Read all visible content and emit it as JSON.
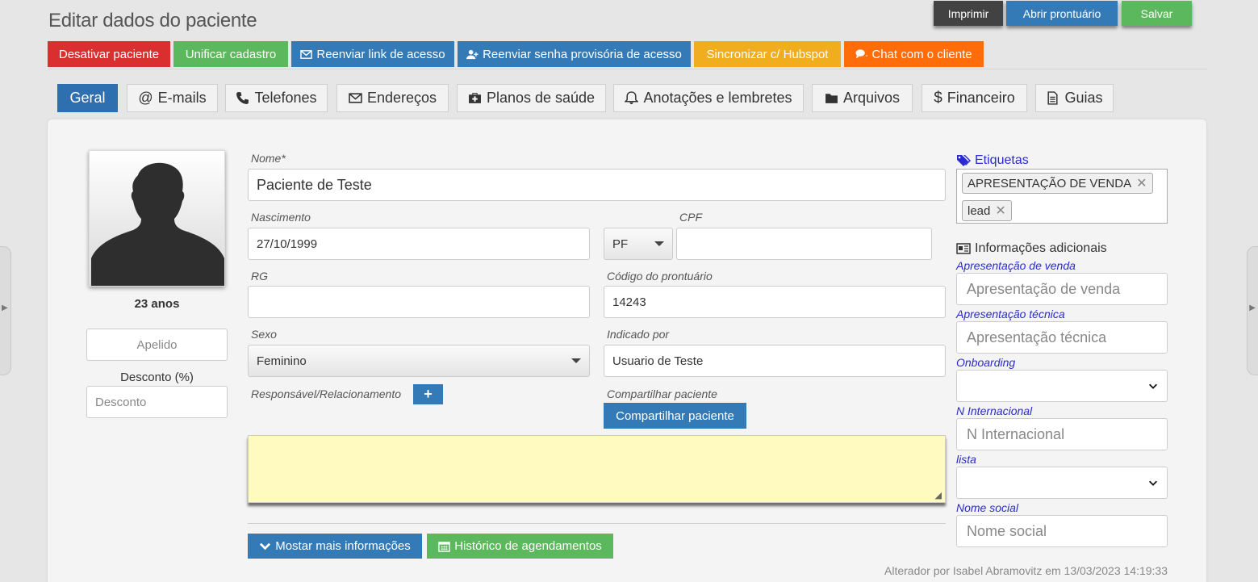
{
  "page": {
    "title": "Editar dados do paciente"
  },
  "actions": {
    "print": "Imprimir",
    "open_record": "Abrir prontuário",
    "save": "Salvar"
  },
  "toolbar": {
    "deactivate": "Desativar paciente",
    "merge": "Unificar cadastro",
    "resend_link": "Reenviar link de acesso",
    "resend_password": "Reenviar senha provisória de acesso",
    "sync_hubspot": "Sincronizar c/ Hubspot",
    "chat": "Chat com o cliente"
  },
  "tabs": [
    {
      "label": "Geral",
      "icon": "none",
      "active": true
    },
    {
      "label": "E-mails",
      "icon": "at-icon"
    },
    {
      "label": "Telefones",
      "icon": "phone-icon"
    },
    {
      "label": "Endereços",
      "icon": "envelope-icon"
    },
    {
      "label": "Planos de saúde",
      "icon": "medkit-icon"
    },
    {
      "label": "Anotações e lembretes",
      "icon": "bell-icon"
    },
    {
      "label": "Arquivos",
      "icon": "folder-icon"
    },
    {
      "label": "Financeiro",
      "icon": "dollar-icon"
    },
    {
      "label": "Guias",
      "icon": "document-icon"
    }
  ],
  "profile": {
    "age": "23 anos",
    "nickname_placeholder": "Apelido",
    "discount_label": "Desconto (%)",
    "discount_placeholder": "Desconto"
  },
  "form": {
    "name_label": "Nome*",
    "name_value": "Paciente de Teste",
    "birth_label": "Nascimento",
    "birth_value": "27/10/1999",
    "cpf_label": "CPF",
    "person_type": "PF",
    "cpf_value": "",
    "rg_label": "RG",
    "rg_value": "",
    "record_code_label": "Código do prontuário",
    "record_code_value": "14243",
    "sex_label": "Sexo",
    "sex_value": "Feminino",
    "referred_label": "Indicado por",
    "referred_value": "Usuario de Teste",
    "responsible_label": "Responsável/Relacionamento",
    "share_label": "Compartilhar paciente",
    "share_button": "Compartilhar paciente",
    "notes_value": "",
    "more_info_button": "Mostar mais informações",
    "history_button": "Histórico de agendamentos",
    "modified_text": "Alterador por Isabel Abramovitz em 13/03/2023 14:19:33"
  },
  "tags": {
    "title": "Etiquetas",
    "items": [
      "APRESENTAÇÃO DE VENDA",
      "lead"
    ]
  },
  "extra": {
    "title": "Informações adicionais",
    "fields": [
      {
        "label": "Apresentação de venda",
        "placeholder": "Apresentação de venda",
        "type": "input"
      },
      {
        "label": "Apresentação técnica",
        "placeholder": "Apresentação técnica",
        "type": "input"
      },
      {
        "label": "Onboarding",
        "placeholder": "",
        "type": "select"
      },
      {
        "label": "N Internacional",
        "placeholder": "N Internacional",
        "type": "input"
      },
      {
        "label": "lista",
        "placeholder": "",
        "type": "select"
      },
      {
        "label": "Nome social",
        "placeholder": "Nome social",
        "type": "input"
      }
    ]
  },
  "colors": {
    "danger": "#d9302f",
    "success": "#5cb85c",
    "primary": "#337ab7",
    "warning": "#f0ad1e",
    "orange": "#ff6c0a",
    "dark": "#424242",
    "notes_bg": "#fffac0",
    "link_blue": "#2a2ad0"
  }
}
